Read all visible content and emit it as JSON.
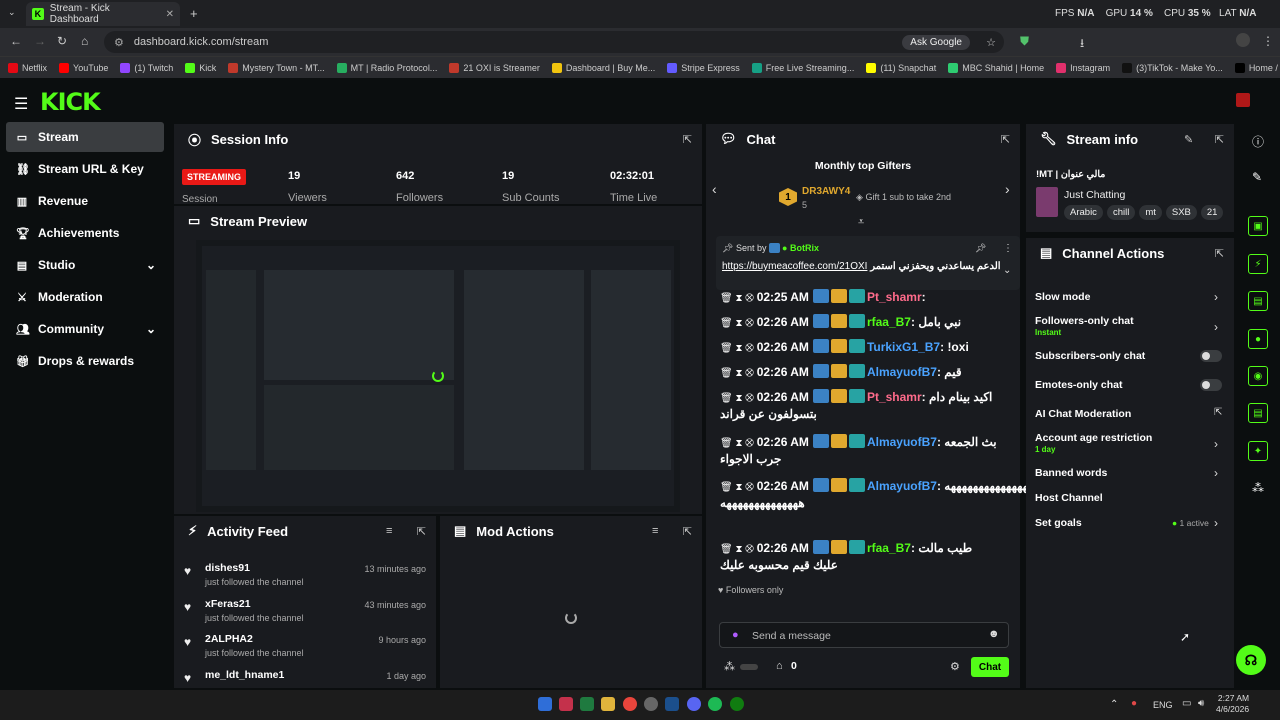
{
  "browser": {
    "tab_title": "Stream - Kick Dashboard",
    "url": "dashboard.kick.com/stream",
    "ask_google": "Ask Google",
    "perf": {
      "fps_label": "FPS",
      "fps": "N/A",
      "gpu_label": "GPU",
      "gpu": "14 %",
      "cpu_label": "CPU",
      "cpu": "35 %",
      "lat_label": "LAT",
      "lat": "N/A"
    },
    "bookmarks": [
      {
        "label": "Netflix",
        "color": "#e50914"
      },
      {
        "label": "YouTube",
        "color": "#ff0000"
      },
      {
        "label": "(1) Twitch",
        "color": "#9146ff"
      },
      {
        "label": "Kick",
        "color": "#53fc18"
      },
      {
        "label": "Mystery Town - MT...",
        "color": "#c0392b"
      },
      {
        "label": "MT | Radio Protocol...",
        "color": "#27ae60"
      },
      {
        "label": "21 OXI is Streamer",
        "color": "#c0392b"
      },
      {
        "label": "Dashboard | Buy Me...",
        "color": "#f1c40f"
      },
      {
        "label": "Stripe Express",
        "color": "#635bff"
      },
      {
        "label": "Free Live Streaming...",
        "color": "#16a085"
      },
      {
        "label": "(11) Snapchat",
        "color": "#fffc00"
      },
      {
        "label": "MBC Shahid | Home",
        "color": "#2ecc71"
      },
      {
        "label": "Instagram",
        "color": "#e1306c"
      },
      {
        "label": "(3)TikTok - Make Yo...",
        "color": "#111111"
      },
      {
        "label": "Home / X",
        "color": "#000000"
      }
    ]
  },
  "sidebar": {
    "items": [
      {
        "label": "Stream"
      },
      {
        "label": "Stream URL & Key"
      },
      {
        "label": "Revenue"
      },
      {
        "label": "Achievements"
      },
      {
        "label": "Studio"
      },
      {
        "label": "Moderation"
      },
      {
        "label": "Community"
      },
      {
        "label": "Drops & rewards"
      }
    ]
  },
  "session": {
    "title": "Session Info",
    "status": "STREAMING",
    "status_sub": "Session",
    "stats": [
      {
        "value": "19",
        "label": "Viewers"
      },
      {
        "value": "642",
        "label": "Followers"
      },
      {
        "value": "19",
        "label": "Sub Counts"
      },
      {
        "value": "02:32:01",
        "label": "Time Live"
      }
    ]
  },
  "preview": {
    "title": "Stream Preview"
  },
  "activity": {
    "title": "Activity Feed",
    "items": [
      {
        "user": "dishes91",
        "action": "just followed the channel",
        "time": "13 minutes ago"
      },
      {
        "user": "xFeras21",
        "action": "just followed the channel",
        "time": "43 minutes ago"
      },
      {
        "user": "2ALPHA2",
        "action": "just followed the channel",
        "time": "9 hours ago"
      },
      {
        "user": "me_ldt_hname1",
        "action": "",
        "time": "1 day ago"
      }
    ]
  },
  "mod": {
    "title": "Mod Actions"
  },
  "chat": {
    "title": "Chat",
    "gifters_title": "Monthly top Gifters",
    "gifter_rank": "1",
    "gifter_name": "DR3AWY4",
    "gifter_count": "5",
    "gift_prompt": "Gift 1 sub to take 2nd",
    "pinned_by": "Sent by",
    "pinned_user": "BotRix",
    "pinned_text": "رابط الدعم يساعدني ويحفزني استمر",
    "pinned_link": "https://buymeacoffee.com/21OXI",
    "messages": [
      {
        "time": "02:25 AM",
        "user": "Pt_shamr",
        "color": "#ff6b8b",
        "text": ""
      },
      {
        "time": "02:26 AM",
        "user": "rfaa_B7",
        "color": "#53fc18",
        "text": "نبي بامل"
      },
      {
        "time": "02:26 AM",
        "user": "TurkixG1_B7",
        "color": "#4aa3ff",
        "text": "!oxi"
      },
      {
        "time": "02:26 AM",
        "user": "AlmayuofB7",
        "color": "#4aa3ff",
        "text": "قيم"
      },
      {
        "time": "02:26 AM",
        "user": "Pt_shamr",
        "color": "#ff6b8b",
        "text": "اكيد بينام دام",
        "text2": "بتسولفون عن قراند"
      },
      {
        "time": "02:26 AM",
        "user": "AlmayuofB7",
        "color": "#4aa3ff",
        "text": "بث الجمعه",
        "text2": "جرب الاجواء"
      },
      {
        "time": "02:26 AM",
        "user": "AlmayuofB7",
        "color": "#4aa3ff",
        "text": "ههههههههههههههههههههههههههههههههههه",
        "text2": "ههههههههههههههه"
      },
      {
        "time": "02:26 AM",
        "user": "rfaa_B7",
        "color": "#53fc18",
        "text": "طيب مالت",
        "text2": "عليك قيم محسوبه عليك"
      }
    ],
    "followers_only": "Followers only",
    "input_placeholder": "Send a message",
    "chat_button": "Chat",
    "counter": "0"
  },
  "stream_info": {
    "title": "Stream info",
    "stream_title": "!MT | مالي عنوان",
    "category": "Just Chatting",
    "tags": [
      "Arabic",
      "chill",
      "mt",
      "SXB",
      "21"
    ]
  },
  "channel_actions": {
    "title": "Channel Actions",
    "items": [
      {
        "label": "Slow mode",
        "sub": ""
      },
      {
        "label": "Followers-only chat",
        "sub": "Instant"
      },
      {
        "label": "Subscribers-only chat",
        "sub": ""
      },
      {
        "label": "Emotes-only chat",
        "sub": ""
      },
      {
        "label": "AI Chat Moderation",
        "sub": ""
      },
      {
        "label": "Account age restriction",
        "sub": "1 day"
      },
      {
        "label": "Banned words",
        "sub": ""
      },
      {
        "label": "Host Channel",
        "sub": ""
      },
      {
        "label": "Set goals",
        "sub": ""
      }
    ],
    "goals_status": "1 active"
  },
  "taskbar": {
    "lang": "ENG",
    "time": "2:27 AM",
    "date": "4/6/2026"
  },
  "colors": {
    "accent": "#53fc18",
    "panel": "#191b1f",
    "bg": "#0b0e0f",
    "streaming": "#e91916"
  }
}
